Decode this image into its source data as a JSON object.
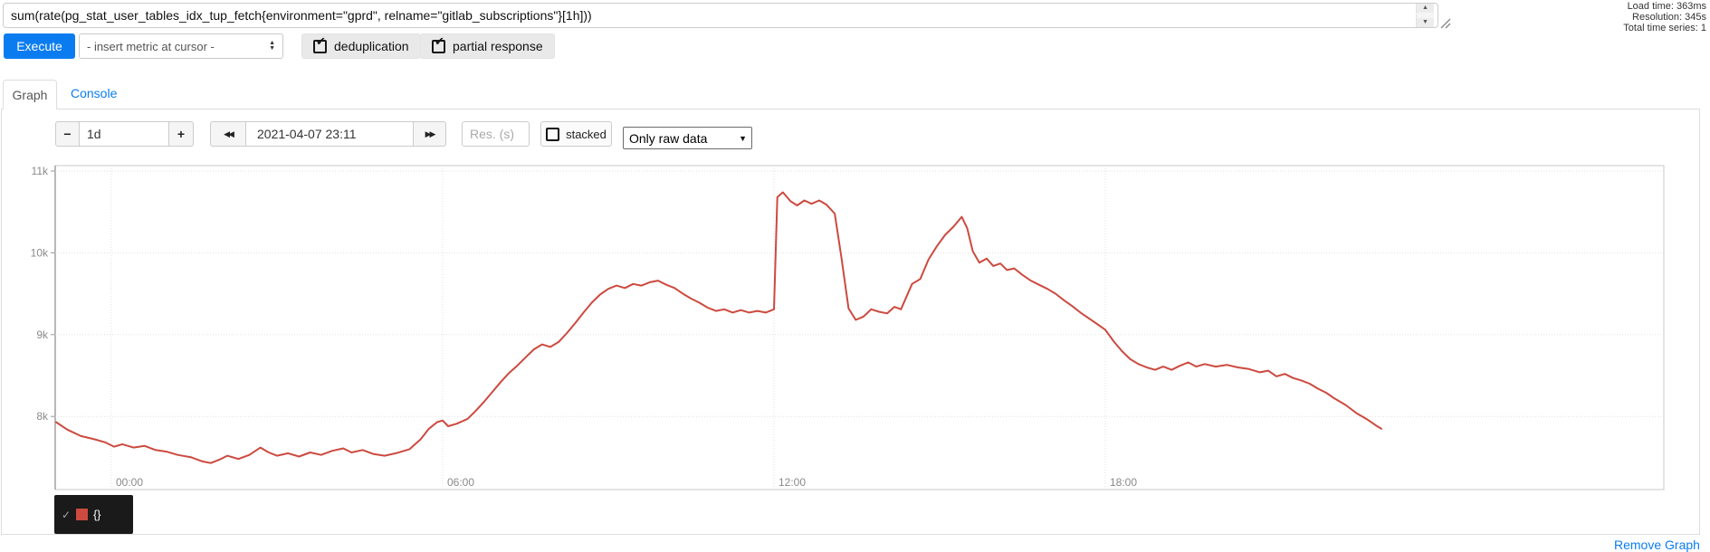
{
  "query": {
    "value": "sum(rate(pg_stat_user_tables_idx_tup_fetch{environment=\"gprd\", relname=\"gitlab_subscriptions\"}[1h]))"
  },
  "stats": {
    "load_time": "Load time: 363ms",
    "resolution": "Resolution: 345s",
    "total_series": "Total time series: 1"
  },
  "toolbar": {
    "execute_label": "Execute",
    "insert_metric_label": "- insert metric at cursor -",
    "dedup_label": "deduplication",
    "partial_label": "partial response"
  },
  "tabs": {
    "graph_label": "Graph",
    "console_label": "Console"
  },
  "graph_controls": {
    "range_decrease_label": "−",
    "range_value": "1d",
    "range_increase_label": "+",
    "jump_back_icon": "◀◀",
    "datetime_value": "2021-04-07 23:11",
    "jump_forward_icon": "▶▶",
    "res_placeholder": "Res. (s)",
    "stacked_label": "stacked",
    "resolution_selected_option": "Only raw data"
  },
  "icons": {
    "check_mark": "✔",
    "legend_check": "✓",
    "select_up": "▲",
    "select_down": "▼",
    "scroll_up": "▲",
    "scroll_down": "▼",
    "dropdown_arrow": "▼"
  },
  "legend": {
    "series_label": "{}"
  },
  "footer": {
    "remove_graph_label": "Remove Graph"
  },
  "colors": {
    "accent_blue": "#0b7cf0",
    "series_red": "#cc4a3f",
    "legend_bg": "#1a1a1a"
  },
  "chart_data": {
    "type": "line",
    "title": "",
    "x_axis_note": "time axis, hours since left edge of data (data starts ~23:11 previous day); tick 00:00 is at h=1",
    "x_range_hours": [
      0,
      24
    ],
    "y_range": [
      7.1,
      11.07
    ],
    "y_unit": "k",
    "grid": true,
    "x_ticks": [
      {
        "h": 1,
        "label": "00:00"
      },
      {
        "h": 7,
        "label": "06:00"
      },
      {
        "h": 13,
        "label": "12:00"
      },
      {
        "h": 19,
        "label": "18:00"
      }
    ],
    "y_ticks": [
      {
        "v": 8,
        "label": "8k"
      },
      {
        "v": 9,
        "label": "9k"
      },
      {
        "v": 10,
        "label": "10k"
      },
      {
        "v": 11,
        "label": "11k"
      }
    ],
    "series": [
      {
        "name": "{}",
        "color": "#cc4a3f",
        "points": [
          [
            0,
            7.93
          ],
          [
            0.2,
            7.84
          ],
          [
            0.45,
            7.76
          ],
          [
            0.7,
            7.72
          ],
          [
            0.9,
            7.68
          ],
          [
            1.05,
            7.63
          ],
          [
            1.2,
            7.66
          ],
          [
            1.4,
            7.62
          ],
          [
            1.6,
            7.64
          ],
          [
            1.8,
            7.59
          ],
          [
            2.0,
            7.57
          ],
          [
            2.2,
            7.53
          ],
          [
            2.45,
            7.5
          ],
          [
            2.65,
            7.45
          ],
          [
            2.8,
            7.43
          ],
          [
            2.95,
            7.47
          ],
          [
            3.1,
            7.52
          ],
          [
            3.3,
            7.48
          ],
          [
            3.5,
            7.53
          ],
          [
            3.7,
            7.62
          ],
          [
            3.85,
            7.56
          ],
          [
            4.0,
            7.52
          ],
          [
            4.2,
            7.55
          ],
          [
            4.4,
            7.51
          ],
          [
            4.6,
            7.56
          ],
          [
            4.8,
            7.53
          ],
          [
            5.0,
            7.58
          ],
          [
            5.2,
            7.61
          ],
          [
            5.35,
            7.56
          ],
          [
            5.55,
            7.59
          ],
          [
            5.75,
            7.54
          ],
          [
            5.95,
            7.52
          ],
          [
            6.15,
            7.55
          ],
          [
            6.4,
            7.6
          ],
          [
            6.6,
            7.72
          ],
          [
            6.75,
            7.85
          ],
          [
            6.9,
            7.93
          ],
          [
            7.0,
            7.95
          ],
          [
            7.1,
            7.88
          ],
          [
            7.25,
            7.91
          ],
          [
            7.45,
            7.97
          ],
          [
            7.6,
            8.07
          ],
          [
            7.75,
            8.18
          ],
          [
            7.9,
            8.3
          ],
          [
            8.05,
            8.42
          ],
          [
            8.2,
            8.53
          ],
          [
            8.35,
            8.62
          ],
          [
            8.5,
            8.72
          ],
          [
            8.65,
            8.82
          ],
          [
            8.8,
            8.88
          ],
          [
            8.95,
            8.85
          ],
          [
            9.1,
            8.91
          ],
          [
            9.25,
            9.02
          ],
          [
            9.4,
            9.14
          ],
          [
            9.55,
            9.27
          ],
          [
            9.7,
            9.39
          ],
          [
            9.85,
            9.49
          ],
          [
            10.0,
            9.56
          ],
          [
            10.15,
            9.6
          ],
          [
            10.3,
            9.57
          ],
          [
            10.45,
            9.62
          ],
          [
            10.6,
            9.6
          ],
          [
            10.75,
            9.64
          ],
          [
            10.9,
            9.66
          ],
          [
            11.05,
            9.61
          ],
          [
            11.2,
            9.57
          ],
          [
            11.35,
            9.5
          ],
          [
            11.5,
            9.44
          ],
          [
            11.65,
            9.39
          ],
          [
            11.8,
            9.33
          ],
          [
            11.95,
            9.29
          ],
          [
            12.1,
            9.31
          ],
          [
            12.25,
            9.27
          ],
          [
            12.4,
            9.3
          ],
          [
            12.55,
            9.27
          ],
          [
            12.7,
            9.29
          ],
          [
            12.85,
            9.27
          ],
          [
            13.0,
            9.31
          ],
          [
            13.06,
            10.68
          ],
          [
            13.16,
            10.74
          ],
          [
            13.3,
            10.63
          ],
          [
            13.42,
            10.58
          ],
          [
            13.55,
            10.64
          ],
          [
            13.68,
            10.6
          ],
          [
            13.82,
            10.64
          ],
          [
            13.95,
            10.59
          ],
          [
            14.1,
            10.48
          ],
          [
            14.22,
            9.95
          ],
          [
            14.35,
            9.32
          ],
          [
            14.48,
            9.18
          ],
          [
            14.62,
            9.22
          ],
          [
            14.76,
            9.31
          ],
          [
            14.9,
            9.28
          ],
          [
            15.05,
            9.26
          ],
          [
            15.18,
            9.34
          ],
          [
            15.3,
            9.31
          ],
          [
            15.5,
            9.62
          ],
          [
            15.65,
            9.68
          ],
          [
            15.8,
            9.92
          ],
          [
            15.95,
            10.08
          ],
          [
            16.1,
            10.22
          ],
          [
            16.25,
            10.32
          ],
          [
            16.4,
            10.44
          ],
          [
            16.5,
            10.3
          ],
          [
            16.6,
            10.02
          ],
          [
            16.72,
            9.88
          ],
          [
            16.85,
            9.93
          ],
          [
            16.97,
            9.84
          ],
          [
            17.1,
            9.87
          ],
          [
            17.22,
            9.79
          ],
          [
            17.35,
            9.81
          ],
          [
            17.5,
            9.73
          ],
          [
            17.65,
            9.66
          ],
          [
            17.8,
            9.61
          ],
          [
            17.95,
            9.56
          ],
          [
            18.1,
            9.5
          ],
          [
            18.25,
            9.42
          ],
          [
            18.4,
            9.35
          ],
          [
            18.55,
            9.27
          ],
          [
            18.7,
            9.2
          ],
          [
            18.85,
            9.13
          ],
          [
            19.0,
            9.06
          ],
          [
            19.15,
            8.92
          ],
          [
            19.3,
            8.8
          ],
          [
            19.45,
            8.7
          ],
          [
            19.6,
            8.64
          ],
          [
            19.75,
            8.6
          ],
          [
            19.9,
            8.57
          ],
          [
            20.05,
            8.61
          ],
          [
            20.2,
            8.57
          ],
          [
            20.35,
            8.62
          ],
          [
            20.5,
            8.66
          ],
          [
            20.65,
            8.61
          ],
          [
            20.8,
            8.64
          ],
          [
            21.0,
            8.61
          ],
          [
            21.2,
            8.63
          ],
          [
            21.4,
            8.6
          ],
          [
            21.6,
            8.58
          ],
          [
            21.8,
            8.54
          ],
          [
            21.95,
            8.56
          ],
          [
            22.1,
            8.49
          ],
          [
            22.25,
            8.52
          ],
          [
            22.4,
            8.47
          ],
          [
            22.55,
            8.44
          ],
          [
            22.7,
            8.4
          ],
          [
            22.85,
            8.34
          ],
          [
            23.0,
            8.29
          ],
          [
            23.15,
            8.22
          ],
          [
            23.35,
            8.14
          ],
          [
            23.55,
            8.04
          ],
          [
            23.75,
            7.96
          ],
          [
            23.9,
            7.89
          ],
          [
            24.0,
            7.85
          ]
        ]
      }
    ],
    "legend_position": "bottom-left"
  }
}
